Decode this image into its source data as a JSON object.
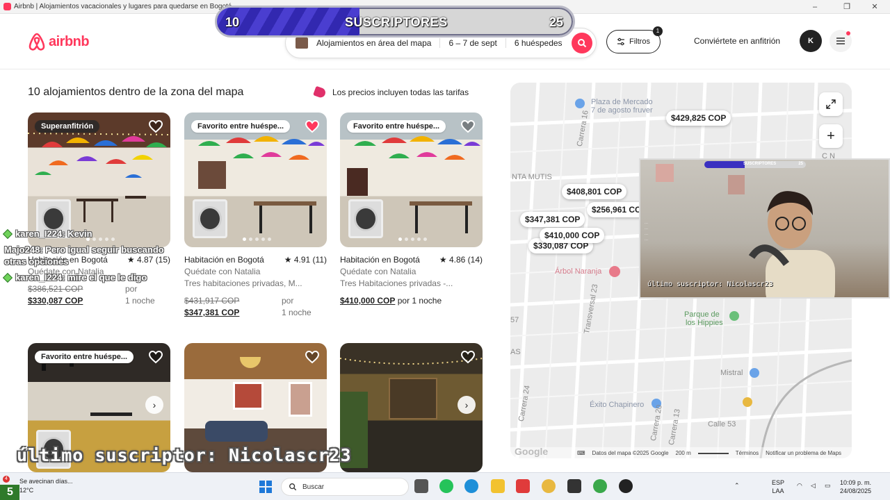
{
  "window": {
    "title": "Airbnb | Alojamientos vacacionales y lugares para quedarse en Bogotá"
  },
  "header": {
    "logo_text": "airbnb",
    "search": {
      "location": "Alojamientos en área del mapa",
      "dates": "6 – 7 de sept",
      "guests": "6 huéspedes"
    },
    "filters_label": "Filtros",
    "filters_count": "1",
    "host_link": "Conviértete en anfitrión",
    "avatar_initial": "K"
  },
  "subscriber_bar": {
    "current": "10",
    "label": "SUSCRIPTORES",
    "goal": "25",
    "progress_fraction": 0.4
  },
  "results": {
    "title": "10 alojamientos dentro de la zona del mapa",
    "price_note": "Los precios incluyen todas las tarifas",
    "listings": [
      {
        "badge": "Superanfitrión",
        "title": "Habitación en Bogotá",
        "rating": "★ 4.87 (15)",
        "host": "Quédate con Natalia",
        "description": "",
        "old_price": "$386,521 COP",
        "new_price": "$330,087 COP",
        "per": "por",
        "nights": "1 noche"
      },
      {
        "badge": "Favorito entre huéspe...",
        "title": "Habitación en Bogotá",
        "rating": "★ 4.91 (11)",
        "host": "Quédate con Natalia",
        "description": "Tres habitaciones privadas, M...",
        "old_price": "$431,917 COP",
        "new_price": "$347,381 COP",
        "per": "por",
        "nights": "1 noche"
      },
      {
        "badge": "Favorito entre huéspe...",
        "title": "Habitación en Bogotá",
        "rating": "★ 4.86 (14)",
        "host": "Quédate con Natalia",
        "description": "Tres Habitaciones privadas -...",
        "price": "$410,000 COP",
        "price_suffix": "por 1 noche"
      },
      {
        "badge": "Favorito entre huéspe..."
      },
      {
        "badge": ""
      },
      {
        "badge": ""
      }
    ]
  },
  "map": {
    "pins": [
      "$429,825 COP",
      "$408,801 COP",
      "$256,961 COP",
      "$347,381 COP",
      "$410,000 COP",
      "$330,087 COP"
    ],
    "labels": {
      "plaza": "Plaza de Mercado",
      "plaza2": "7 de agosto fruver",
      "mutis": "NTA MUTIS",
      "arbol": "Árbol Naranja",
      "hippies": "Parque de",
      "hippies2": "los Hippies",
      "mistral": "Mistral",
      "exito": "Éxito Chapinero",
      "calle53": "Calle 53",
      "carrera16": "Carrera 16",
      "carrera24": "Carrera 24",
      "transversal": "Transversal 23",
      "carrera13": "Carrera 13",
      "carrera20": "Carrera 20",
      "n57": "57",
      "as": "AS",
      "cn": "C N"
    },
    "footer": {
      "google": "Google",
      "data": "Datos del mapa ©2025 Google",
      "scale": "200 m",
      "terms": "Términos",
      "report": "Notificar un problema de Maps"
    }
  },
  "stream": {
    "chat": [
      {
        "user": "karen_I224",
        "message": ": Kevin",
        "diamond": true
      },
      {
        "user": "Majo248",
        "message": ": Pero igual seguir buscando otras opciones",
        "diamond": false
      },
      {
        "user": "karen_I224",
        "message": ": mire el que le digo",
        "diamond": true
      }
    ],
    "last_subscriber": "último suscriptor: Nicolascr23",
    "cam_caption": "último suscriptor: Nicolascr23",
    "cam_mini_label": "SUSCRIPTORES",
    "cam_mini_goal": "25"
  },
  "taskbar": {
    "weather_line1": "Se avecinan días...",
    "weather_line2": "12°C",
    "weather_badge": "4",
    "search_placeholder": "Buscar",
    "lang1": "ESP",
    "lang2": "LAA",
    "time": "10:09 p. m.",
    "date": "24/08/2025",
    "corner_badge": "5"
  },
  "colors": {
    "brand": "#ff385c",
    "sub_fill": "#3a30c0"
  }
}
